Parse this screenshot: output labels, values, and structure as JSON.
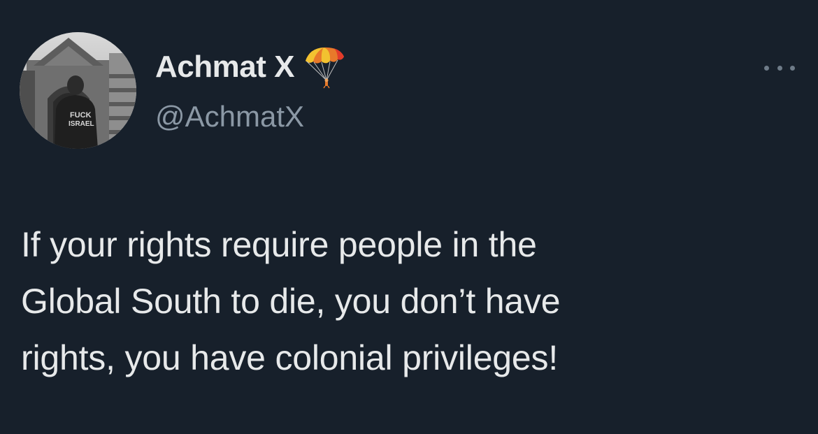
{
  "author": {
    "display_name": "Achmat X",
    "handle": "@AchmatX",
    "name_emoji": "parachute-emoji",
    "avatar": {
      "description_icon": "profile-photo",
      "shirt_text_line1": "FUCK",
      "shirt_text_line2": "ISRAEL"
    }
  },
  "menu": {
    "icon": "more-horizontal-icon"
  },
  "tweet": {
    "lines": [
      "If your rights require people in the",
      "Global South to die, you don’t have",
      "rights, you have colonial privileges!"
    ]
  },
  "colors": {
    "background": "#17202b",
    "primary_text": "#e7e9ea",
    "secondary_text": "#8b98a5",
    "more_dots": "#6e7b88"
  }
}
